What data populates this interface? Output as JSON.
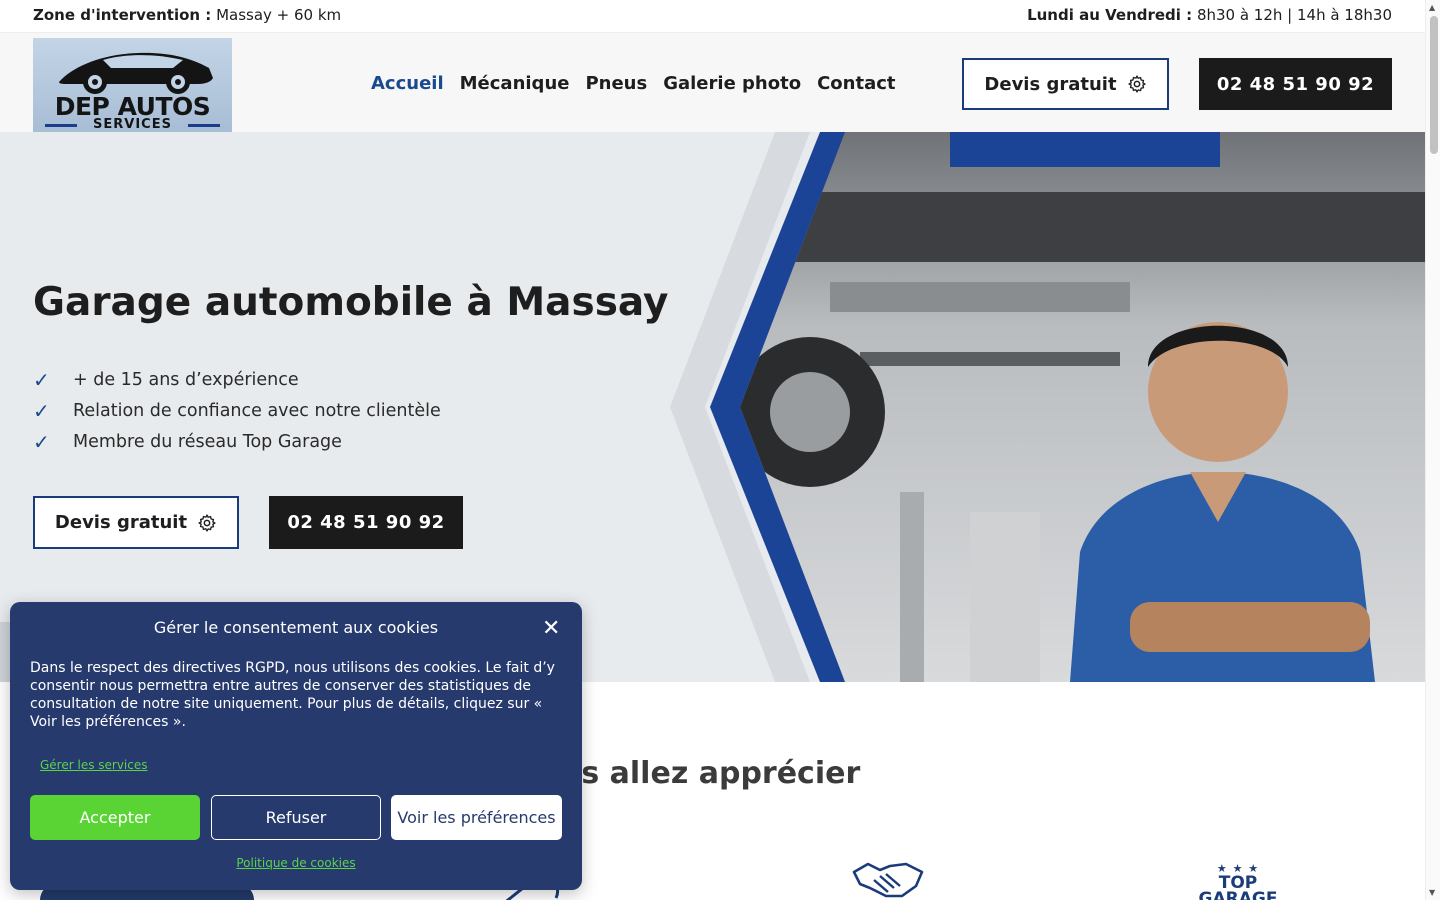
{
  "topbar": {
    "zone_label": "Zone d'intervention :",
    "zone_value": "Massay + 60 km",
    "hours_label": "Lundi au Vendredi :",
    "hours_value": "8h30 à 12h | 14h à 18h30"
  },
  "logo": {
    "line1": "DEP AUTOS",
    "line2": "SERVICES",
    "reg": "®"
  },
  "nav": {
    "items": [
      {
        "label": "Accueil",
        "active": true
      },
      {
        "label": "Mécanique"
      },
      {
        "label": "Pneus"
      },
      {
        "label": "Galerie photo"
      },
      {
        "label": "Contact"
      }
    ]
  },
  "header_cta": {
    "quote": "Devis gratuit",
    "phone": "02 48 51 90 92"
  },
  "hero": {
    "title": "Garage automobile à Massay",
    "bullets": [
      "+ de 15 ans d’expérience",
      "Relation de confiance avec notre clientèle",
      "Membre du réseau Top Garage"
    ],
    "quote_button": "Devis gratuit",
    "phone_button": "02 48 51 90 92"
  },
  "section": {
    "title_partial": "us allez apprécier",
    "badge_line1": "TOP",
    "badge_line2": "GARAGE",
    "badge_stars": "★ ★ ★"
  },
  "cookie": {
    "title": "Gérer le consentement aux cookies",
    "text": "Dans le respect des directives RGPD, nous utilisons des cookies. Le fait d’y consentir nous permettra entre autres de conserver des statistiques de consultation de notre site uniquement. Pour plus de détails, cliquez sur « Voir les préférences ».",
    "manage_services": "Gérer les services",
    "accept": "Accepter",
    "refuse": "Refuser",
    "preferences": "Voir les préférences",
    "policy": "Politique de cookies"
  },
  "colors": {
    "brand_navy": "#1a3c7a",
    "cookie_bg": "#273a6e",
    "accept_green": "#5ad434",
    "link_green": "#5ad34a",
    "nav_active": "#1a4a8e"
  },
  "icons": [
    "gear-icon",
    "check-icon",
    "close-icon",
    "handshake-icon",
    "wrench-icon"
  ]
}
